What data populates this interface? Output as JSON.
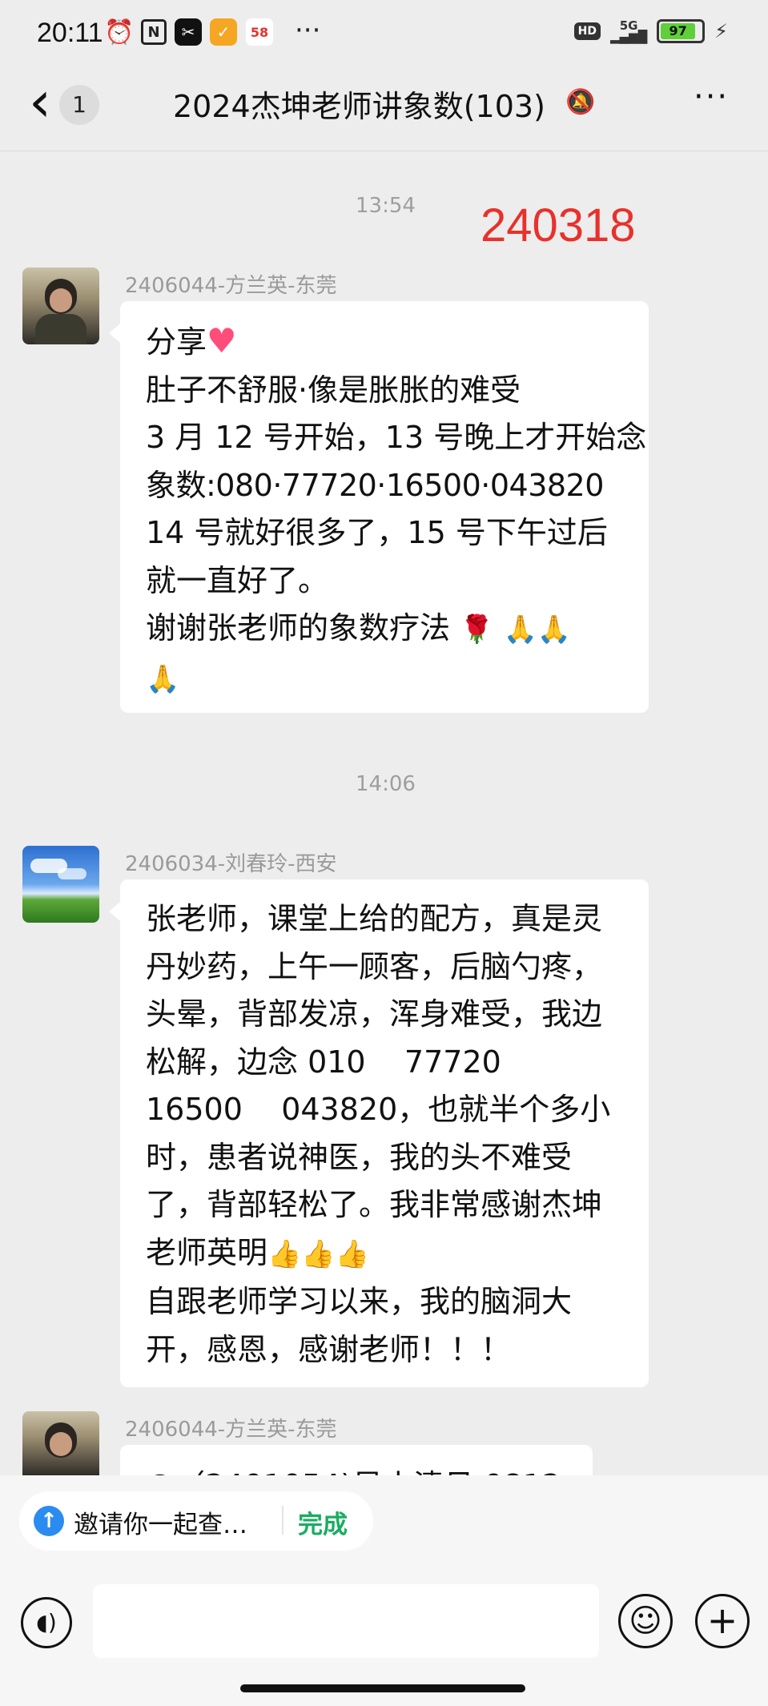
{
  "status_bar": {
    "time": "20:11",
    "icons": [
      "alarm-icon",
      "nfc-icon",
      "app-icon",
      "app-icon",
      "58-app-icon"
    ],
    "more": "···",
    "hd": "HD",
    "network": "5G",
    "battery": "97"
  },
  "header": {
    "back": "‹",
    "unread_count": "1",
    "title": "2024杰坤老师讲象数(103)",
    "more": "···"
  },
  "annotation": "240318",
  "messages": [
    {
      "time": "13:54",
      "sender": "2406044-方兰英-东莞",
      "lines": [
        "分享",
        "肚子不舒服·像是胀胀的难受",
        "3 月 12 号开始，13 号晚上才开始念",
        "象数:080·77720·16500·043820",
        "14 号就好很多了，15 号下午过后",
        "就一直好了。",
        "谢谢张老师的象数疗法"
      ],
      "emoji": {
        "heart": "♥",
        "rose": "🌹",
        "pray": "🙏"
      }
    },
    {
      "time": "14:06",
      "sender": "2406034-刘春玲-西安",
      "lines": [
        "张老师，课堂上给的配方，真是灵",
        "丹妙药，上午一顾客，后脑勺疼，",
        "头晕，背部发凉，浑身难受，我边",
        "松解，边念 010    77720",
        "16500    043820，也就半个多小",
        "时，患者说神医，我的头不难受",
        "了，背部轻松了。我非常感谢杰坤",
        "老师英明",
        "自跟老师学习以来，我的脑洞大",
        "开，感恩，感谢老师！！！"
      ],
      "emoji": {
        "thumbs": "👍"
      }
    },
    {
      "sender": "2406044-方兰英-东莞",
      "partial_text": "@（2401054)吴小清见 0812"
    }
  ],
  "bottom": {
    "invite_text": "邀请你一起查…",
    "done_label": "完成"
  },
  "colors": {
    "background": "#ededed",
    "bubble": "#ffffff",
    "annotation": "#e8312b",
    "done": "#19ad61"
  }
}
